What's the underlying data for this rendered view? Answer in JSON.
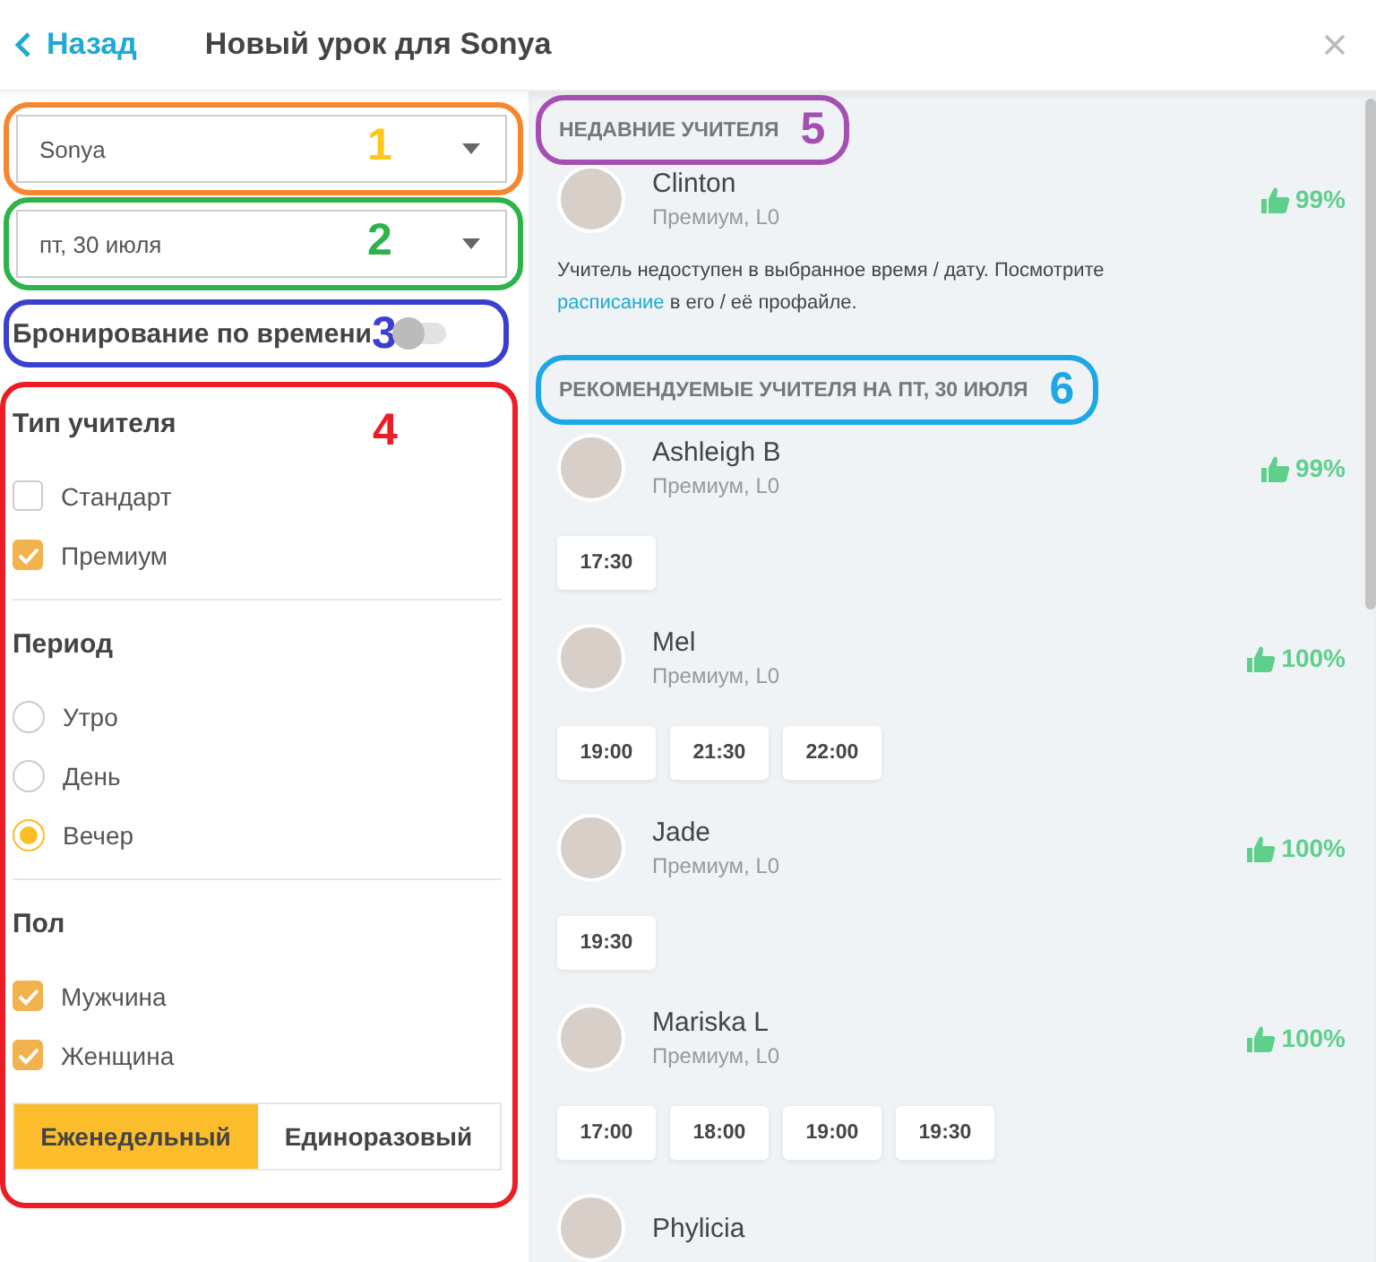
{
  "header": {
    "back_label": "Назад",
    "title": "Новый урок для Sonya"
  },
  "student_select": {
    "value": "Sonya",
    "annotation": {
      "outline": {
        "color": "#f7862f"
      },
      "number": {
        "label": "1",
        "color": "#ffc61a"
      }
    }
  },
  "date_select": {
    "value": "пт, 30 июля",
    "annotation": {
      "outline": {
        "color": "#2eb24a"
      },
      "number": {
        "label": "2",
        "color": "#2eb24a"
      }
    }
  },
  "time_booking": {
    "label": "Бронирование по времени",
    "on": false,
    "annotation": {
      "outline": {
        "color": "#3b3fcf"
      },
      "number": {
        "label": "3",
        "color": "#3b3fcf"
      }
    }
  },
  "filters_annotation": {
    "outline": {
      "color": "#ee1c25"
    },
    "number": {
      "label": "4",
      "color": "#ee1c25"
    }
  },
  "filters": [
    {
      "title": "Тип учителя",
      "options": [
        {
          "label": "Стандарт",
          "kind": "checkbox",
          "checked": false
        },
        {
          "label": "Премиум",
          "kind": "checkbox",
          "checked": true
        }
      ]
    },
    {
      "title": "Период",
      "options": [
        {
          "label": "Утро",
          "kind": "radio",
          "selected": false
        },
        {
          "label": "День",
          "kind": "radio",
          "selected": false
        },
        {
          "label": "Вечер",
          "kind": "radio",
          "selected": true
        }
      ]
    },
    {
      "title": "Пол",
      "options": [
        {
          "label": "Мужчина",
          "kind": "checkbox",
          "checked": true
        },
        {
          "label": "Женщина",
          "kind": "checkbox",
          "checked": true
        }
      ]
    }
  ],
  "frequency": [
    {
      "label": "Еженедельный",
      "selected": true
    },
    {
      "label": "Единоразовый",
      "selected": false
    }
  ],
  "recent": {
    "title": "НЕДАВНИЕ УЧИТЕЛЯ",
    "annotation": {
      "outline": {
        "color": "#a54fb3"
      },
      "number": {
        "label": "5",
        "color": "#a54fb3"
      }
    },
    "teachers": [
      {
        "name": "Clinton",
        "level": "Премиум, L0",
        "rating": "99%"
      }
    ],
    "note_before": "Учитель недоступен в выбранное время / дату. Посмотрите ",
    "note_link": "расписание",
    "note_after": " в его / её профайле."
  },
  "recommended": {
    "title": "РЕКОМЕНДУЕМЫЕ УЧИТЕЛЯ НА ПТ, 30 ИЮЛЯ",
    "annotation": {
      "outline": {
        "color": "#1ea7e6"
      },
      "number": {
        "label": "6",
        "color": "#1ea7e6"
      }
    },
    "teachers": [
      {
        "name": "Ashleigh B",
        "level": "Премиум, L0",
        "rating": "99%",
        "slots": [
          "17:30"
        ]
      },
      {
        "name": "Mel",
        "level": "Премиум, L0",
        "rating": "100%",
        "slots": [
          "19:00",
          "21:30",
          "22:00"
        ]
      },
      {
        "name": "Jade",
        "level": "Премиум, L0",
        "rating": "100%",
        "slots": [
          "19:30"
        ]
      },
      {
        "name": "Mariska L",
        "level": "Премиум, L0",
        "rating": "100%",
        "slots": [
          "17:00",
          "18:00",
          "19:00",
          "19:30"
        ]
      },
      {
        "name": "Phylicia"
      }
    ]
  }
}
